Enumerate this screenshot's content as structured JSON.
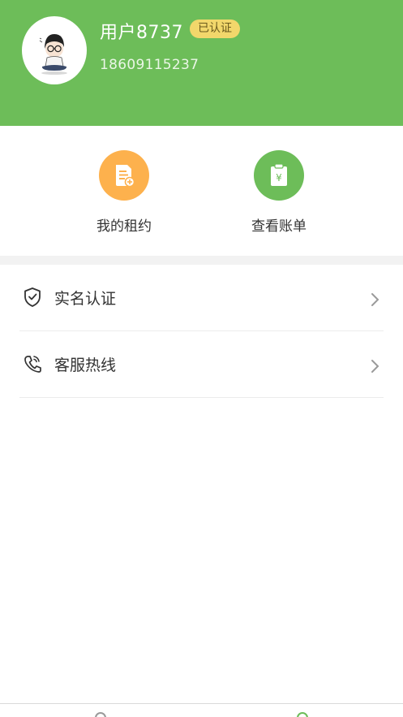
{
  "profile": {
    "username": "用户8737",
    "verified_badge": "已认证",
    "phone": "18609115237"
  },
  "quick_actions": [
    {
      "label": "我的租约",
      "icon": "document-icon",
      "color": "#fdb14d"
    },
    {
      "label": "查看账单",
      "icon": "bill-icon",
      "color": "#6dbd59"
    }
  ],
  "menu": [
    {
      "label": "实名认证",
      "icon": "shield-check-icon"
    },
    {
      "label": "客服热线",
      "icon": "phone-call-icon"
    }
  ],
  "colors": {
    "brand_green": "#6dbd59",
    "orange": "#fdb14d",
    "badge_yellow": "#f2d76b"
  }
}
